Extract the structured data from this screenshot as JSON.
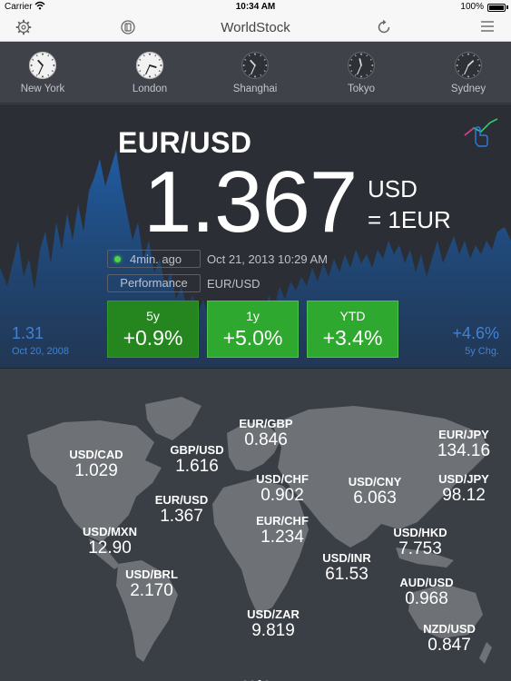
{
  "status": {
    "carrier": "Carrier",
    "time": "10:34 AM",
    "battery": "100%"
  },
  "nav": {
    "title": "WorldStock"
  },
  "clocks": [
    {
      "city": "New York",
      "hour": 10,
      "minute": 34,
      "day": true
    },
    {
      "city": "London",
      "hour": 15,
      "minute": 34,
      "day": true
    },
    {
      "city": "Shanghai",
      "hour": 22,
      "minute": 34,
      "day": false
    },
    {
      "city": "Tokyo",
      "hour": 23,
      "minute": 34,
      "day": false
    },
    {
      "city": "Sydney",
      "hour": 1,
      "minute": 34,
      "day": false
    }
  ],
  "hero": {
    "pair": "EUR/USD",
    "rate": "1.367",
    "unit_top": "USD",
    "unit_bottom": "= 1EUR",
    "updated": "4min. ago",
    "datetime": "Oct 21, 2013 10:29 AM",
    "performance_label": "Performance",
    "performance_pair": "EUR/USD",
    "buttons": [
      {
        "label": "5y",
        "value": "+0.9%",
        "active": true
      },
      {
        "label": "1y",
        "value": "+5.0%",
        "active": false
      },
      {
        "label": "YTD",
        "value": "+3.4%",
        "active": false
      }
    ],
    "start_value": "1.31",
    "start_date": "Oct 20, 2008",
    "change_value": "+4.6%",
    "change_label": "5y Chg."
  },
  "colors": {
    "accent_green": "#2fa82f",
    "chart_blue": "#1d5aa0",
    "link_blue": "#3f82d6"
  },
  "quotes": [
    {
      "pair": "EUR/GBP",
      "value": "0.846"
    },
    {
      "pair": "EUR/JPY",
      "value": "134.16"
    },
    {
      "pair": "USD/CAD",
      "value": "1.029"
    },
    {
      "pair": "GBP/USD",
      "value": "1.616"
    },
    {
      "pair": "USD/CHF",
      "value": "0.902"
    },
    {
      "pair": "USD/CNY",
      "value": "6.063"
    },
    {
      "pair": "USD/JPY",
      "value": "98.12"
    },
    {
      "pair": "EUR/USD",
      "value": "1.367"
    },
    {
      "pair": "EUR/CHF",
      "value": "1.234"
    },
    {
      "pair": "USD/MXN",
      "value": "12.90"
    },
    {
      "pair": "USD/HKD",
      "value": "7.753"
    },
    {
      "pair": "USD/INR",
      "value": "61.53"
    },
    {
      "pair": "USD/BRL",
      "value": "2.170"
    },
    {
      "pair": "AUD/USD",
      "value": "0.968"
    },
    {
      "pair": "USD/ZAR",
      "value": "9.819"
    },
    {
      "pair": "NZD/USD",
      "value": "0.847"
    }
  ],
  "page_indicator": {
    "count": 4,
    "current": 3
  }
}
